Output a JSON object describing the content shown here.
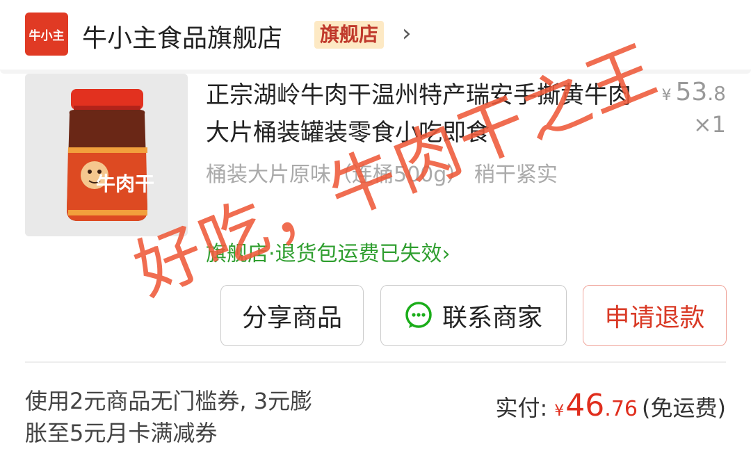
{
  "shop": {
    "logo_text": "牛小主",
    "name": "牛小主食品旗舰店",
    "badge": "旗舰店",
    "arrow": "›"
  },
  "product": {
    "title": "正宗湖岭牛肉干温州特产瑞安手撕黄牛肉大片桶装罐装零食小吃即食",
    "price": {
      "yen": "¥",
      "int": "53",
      "dec": ".8"
    },
    "quantity": "×1",
    "spec": "桶装大片原味（连桶500g） 稍干紧实",
    "service": "旗舰店·退货包运费已失效",
    "service_arrow": "›",
    "image_label_text": "牛肉干"
  },
  "buttons": {
    "share": "分享商品",
    "contact": "联系商家",
    "refund": "申请退款"
  },
  "summary": {
    "coupon_text": "使用2元商品无门槛券, 3元膨胀至5元月卡满减券",
    "paid_label": "实付:",
    "paid_yen": "¥",
    "paid_int": "46",
    "paid_dec": ".76",
    "shipping": "(免运费)"
  },
  "watermark": "好吃，牛肉干之王",
  "colors": {
    "brand_red": "#e03a24",
    "service_green": "#2f9e2f",
    "price_red": "#e02e1d",
    "badge_bg": "#fde9c4"
  }
}
